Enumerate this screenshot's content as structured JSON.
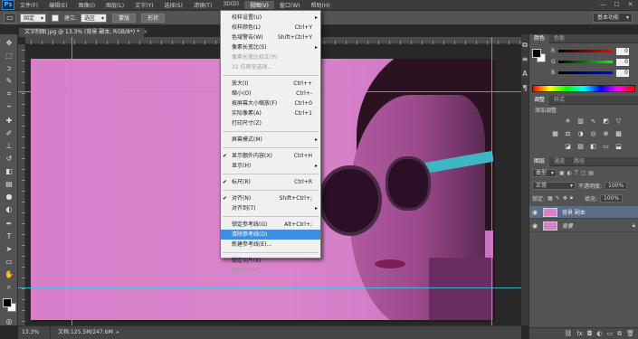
{
  "menubar": {
    "logo": "Ps",
    "items": [
      "文件(F)",
      "编辑(E)",
      "图像(I)",
      "图层(L)",
      "文字(Y)",
      "选择(S)",
      "滤镜(T)",
      "3D(D)",
      "视图(V)",
      "窗口(W)",
      "帮助(H)"
    ],
    "active_index": 8,
    "window_controls": [
      "—",
      "☐",
      "✕"
    ]
  },
  "options": {
    "tool_glyph": "▭",
    "style_value": "固定",
    "feather_label": "建立:",
    "select_value": "选区",
    "button1": "蒙版",
    "button2": "形状",
    "workspace": "基本功能"
  },
  "document": {
    "tab_title": "文字制图.jpg @ 13.3% (背景 副本, RGB/8*) *",
    "tab_close": "×",
    "zoom": "13.3%",
    "doc_info": "文档:125.5M/247.6M",
    "status_arrow": "▸"
  },
  "view_menu": {
    "items": [
      {
        "label": "校样设置(U)",
        "shortcut": "",
        "submenu": true
      },
      {
        "label": "校样颜色(L)",
        "shortcut": "Ctrl+Y"
      },
      {
        "label": "色域警告(W)",
        "shortcut": "Shift+Ctrl+Y"
      },
      {
        "label": "像素长宽比(S)",
        "shortcut": "",
        "submenu": true
      },
      {
        "label": "像素长宽比校正(P)",
        "shortcut": "",
        "disabled": true
      },
      {
        "label": "32 位预览选项...",
        "shortcut": "",
        "disabled": true
      },
      {
        "sep": true
      },
      {
        "label": "放大(I)",
        "shortcut": "Ctrl++"
      },
      {
        "label": "缩小(O)",
        "shortcut": "Ctrl+-"
      },
      {
        "label": "按屏幕大小缩放(F)",
        "shortcut": "Ctrl+0"
      },
      {
        "label": "实际像素(A)",
        "shortcut": "Ctrl+1"
      },
      {
        "label": "打印尺寸(Z)",
        "shortcut": ""
      },
      {
        "sep": true
      },
      {
        "label": "屏幕模式(M)",
        "shortcut": "",
        "submenu": true
      },
      {
        "sep": true
      },
      {
        "label": "显示额外内容(X)",
        "shortcut": "Ctrl+H",
        "checked": true
      },
      {
        "label": "显示(H)",
        "shortcut": "",
        "submenu": true
      },
      {
        "sep": true
      },
      {
        "label": "标尺(R)",
        "shortcut": "Ctrl+R",
        "checked": true
      },
      {
        "sep": true
      },
      {
        "label": "对齐(N)",
        "shortcut": "Shift+Ctrl+;",
        "checked": true
      },
      {
        "label": "对齐到(T)",
        "shortcut": "",
        "submenu": true
      },
      {
        "sep": true
      },
      {
        "label": "锁定参考线(G)",
        "shortcut": "Alt+Ctrl+;"
      },
      {
        "label": "清除参考线(D)",
        "shortcut": "",
        "highlight": true
      },
      {
        "label": "新建参考线(E)...",
        "shortcut": ""
      },
      {
        "sep": true
      },
      {
        "label": "锁定切片(K)",
        "shortcut": ""
      },
      {
        "label": "清除切片(C)",
        "shortcut": "",
        "disabled": true
      }
    ]
  },
  "color_panel": {
    "tabs": [
      "颜色",
      "色板"
    ],
    "r_label": "R",
    "g_label": "G",
    "b_label": "B",
    "r_value": "0",
    "g_value": "0",
    "b_value": "0"
  },
  "adjust_panel": {
    "tabs": [
      "调整",
      "样式"
    ],
    "title": "添加调整"
  },
  "layers_panel": {
    "tabs": [
      "图层",
      "通道",
      "路径"
    ],
    "kind_filter": "类型",
    "blend_mode": "正常",
    "opacity_label": "不透明度:",
    "opacity_value": "100%",
    "lock_label": "锁定:",
    "fill_label": "填充:",
    "fill_value": "100%",
    "layers": [
      {
        "name": "背景 副本",
        "selected": true
      },
      {
        "name": "背景",
        "locked": true
      }
    ],
    "footer_icons": [
      "link-icon",
      "fx-icon",
      "mask-icon",
      "adjust-icon",
      "folder-icon",
      "new-layer-icon",
      "trash-icon"
    ]
  },
  "colors": {
    "photo_bg": "#d780c9",
    "guide": "#3ec3e6",
    "menu_highlight": "#3a8fe0",
    "glasses_temple": "#3eb6c4"
  }
}
